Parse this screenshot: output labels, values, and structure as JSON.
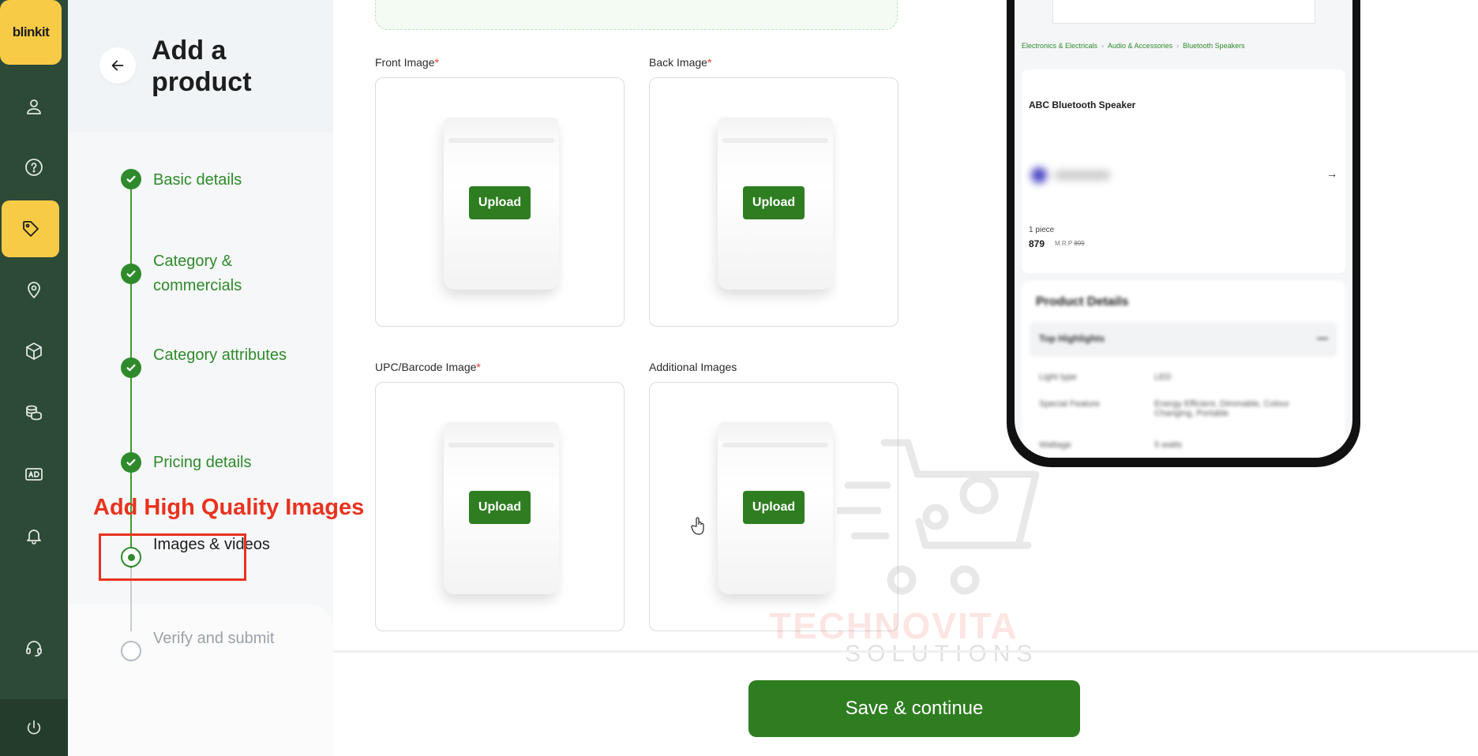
{
  "app": {
    "brand": "blinkit"
  },
  "sidebar": {
    "items": [
      {
        "name": "profile",
        "icon": "user-icon"
      },
      {
        "name": "help",
        "icon": "help-circle-icon"
      },
      {
        "name": "products",
        "icon": "tag-icon",
        "active": true
      },
      {
        "name": "locations",
        "icon": "map-pin-icon"
      },
      {
        "name": "inventory",
        "icon": "box-icon"
      },
      {
        "name": "payments",
        "icon": "coins-icon"
      },
      {
        "name": "ads",
        "icon": "ad-icon"
      },
      {
        "name": "notifications",
        "icon": "bell-icon"
      },
      {
        "name": "support",
        "icon": "headset-icon"
      },
      {
        "name": "logout",
        "icon": "power-icon"
      }
    ]
  },
  "panel": {
    "title": "Add a product",
    "steps": [
      {
        "label": "Basic details",
        "status": "done"
      },
      {
        "label": "Category & commercials",
        "status": "done"
      },
      {
        "label": "Category attributes",
        "status": "done"
      },
      {
        "label": "Pricing details",
        "status": "done"
      },
      {
        "label": "Images & videos",
        "status": "current"
      },
      {
        "label": "Verify and submit",
        "status": "pending"
      }
    ]
  },
  "annotation": {
    "text": "Add High Quality Images",
    "color": "#e8321e"
  },
  "uploads": [
    {
      "label": "Front Image",
      "required": "*",
      "button": "Upload"
    },
    {
      "label": "Back Image",
      "required": "*",
      "button": "Upload"
    },
    {
      "label": "UPC/Barcode Image",
      "required": "*",
      "button": "Upload"
    },
    {
      "label": "Additional Images",
      "required": "",
      "button": "Upload"
    }
  ],
  "footer": {
    "save_label": "Save & continue"
  },
  "preview": {
    "breadcrumbs": [
      "Electronics & Electricals",
      "Audio & Accessories",
      "Bluetooth Speakers"
    ],
    "product_name": "ABC Bluetooth Speaker",
    "quantity": "1 piece",
    "price": "879",
    "mrp_label": "M.R.P",
    "mrp_value": "899",
    "details_title": "Product Details",
    "highlights_label": "Top Highlights",
    "specs": [
      {
        "key": "Light type",
        "value": "LED"
      },
      {
        "key": "Special Feature",
        "value": "Energy Efficient, Dimmable, Colour Changing, Portable"
      },
      {
        "key": "Wattage",
        "value": "5 watts"
      }
    ]
  },
  "watermark": {
    "name": "TECHNOVITA",
    "sub": "SOLUTIONS"
  },
  "colors": {
    "brand_green": "#2f7d21",
    "accent_yellow": "#f8cb46",
    "rail": "#2d4a37"
  }
}
